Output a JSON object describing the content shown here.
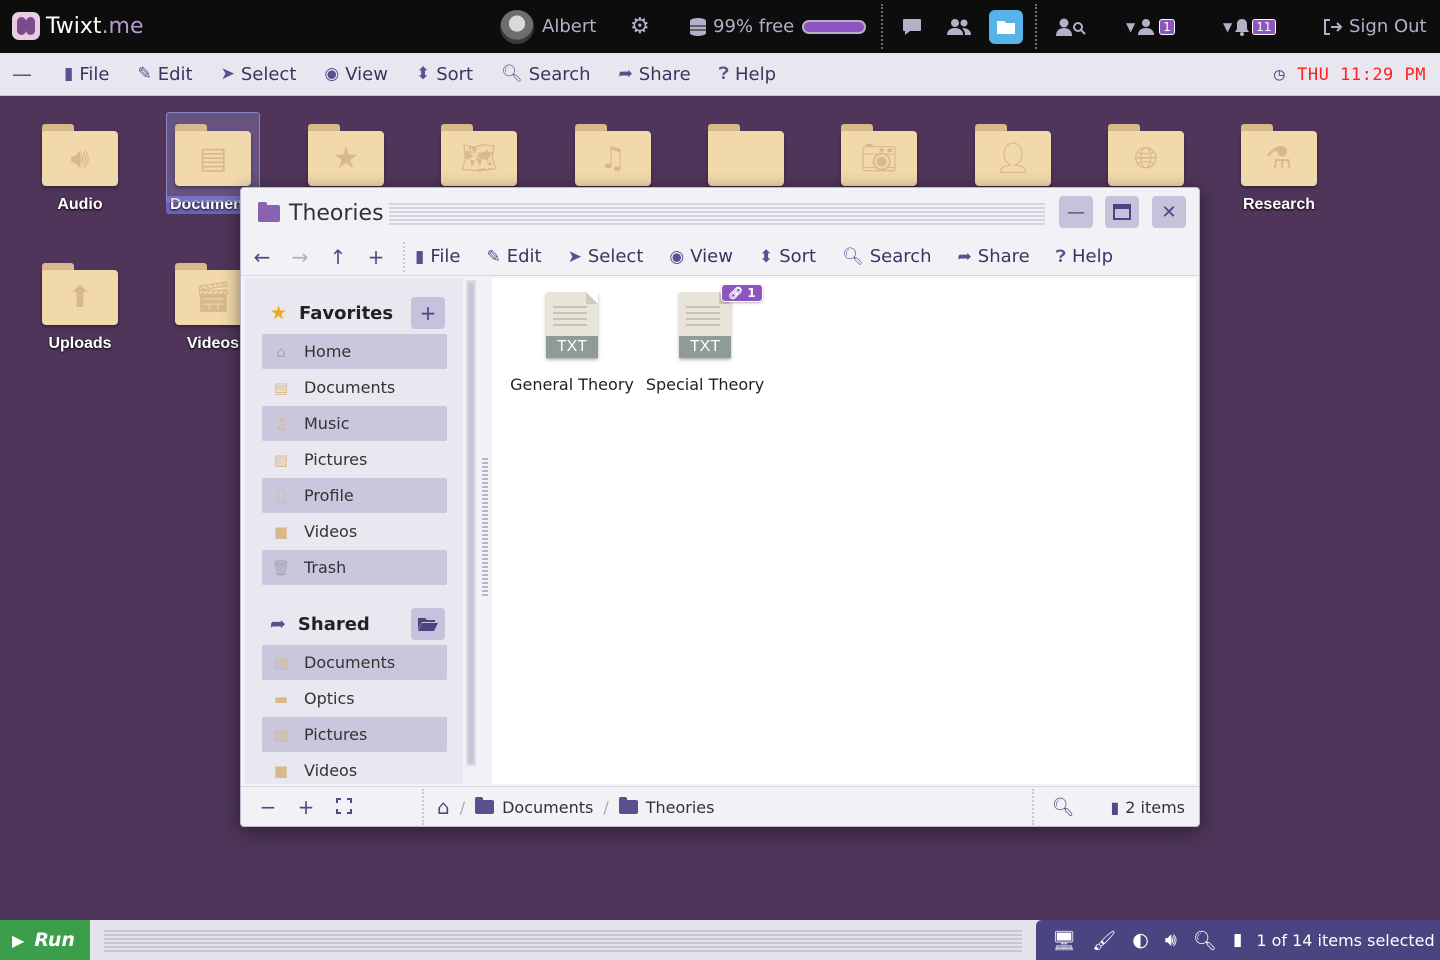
{
  "brand": {
    "name": "Twixt",
    "tld": ".me"
  },
  "topbar": {
    "user": "Albert",
    "storage": "99% free",
    "storage_level": 0.99,
    "mail_count": "1",
    "notif_count": "11",
    "sign_out": "Sign Out"
  },
  "menubar": {
    "file": "File",
    "edit": "Edit",
    "select": "Select",
    "view": "View",
    "sort": "Sort",
    "search": "Search",
    "share": "Share",
    "help": "Help",
    "clock": "THU 11:29 PM"
  },
  "desktop": {
    "icons": [
      {
        "label": "Audio",
        "icon": "speaker-icon"
      },
      {
        "label": "Documents",
        "icon": "document-icon",
        "selected": true
      },
      {
        "label": "",
        "icon": "star-icon"
      },
      {
        "label": "",
        "icon": "map-icon"
      },
      {
        "label": "",
        "icon": "music-icon"
      },
      {
        "label": "",
        "icon": "blank-icon"
      },
      {
        "label": "",
        "icon": "camera-icon"
      },
      {
        "label": "",
        "icon": "person-icon"
      },
      {
        "label": "",
        "icon": "globe-icon"
      },
      {
        "label": "Research",
        "icon": "flask-icon"
      },
      {
        "label": "Uploads",
        "icon": "upload-icon"
      },
      {
        "label": "Videos",
        "icon": "film-icon"
      }
    ]
  },
  "window": {
    "title": "Theories",
    "toolbar": {
      "file": "File",
      "edit": "Edit",
      "select": "Select",
      "view": "View",
      "sort": "Sort",
      "search": "Search",
      "share": "Share",
      "help": "Help"
    },
    "sidebar": {
      "favorites_title": "Favorites",
      "favorites": [
        "Home",
        "Documents",
        "Music",
        "Pictures",
        "Profile",
        "Videos",
        "Trash"
      ],
      "shared_title": "Shared",
      "shared": [
        "Documents",
        "Optics",
        "Pictures",
        "Videos"
      ]
    },
    "files": [
      {
        "name": "General Theory",
        "ext": "TXT",
        "shares": ""
      },
      {
        "name": "Special Theory",
        "ext": "TXT",
        "shares": "1"
      }
    ],
    "breadcrumb": [
      "Documents",
      "Theories"
    ],
    "item_count": "2 items"
  },
  "taskbar": {
    "run": "Run",
    "selection": "1 of 14 items selected"
  },
  "colors": {
    "desktop_bg": "#4e3559",
    "accent": "#8e54c0",
    "run_green": "#3a9e4a",
    "clock_red": "#ff2020"
  }
}
